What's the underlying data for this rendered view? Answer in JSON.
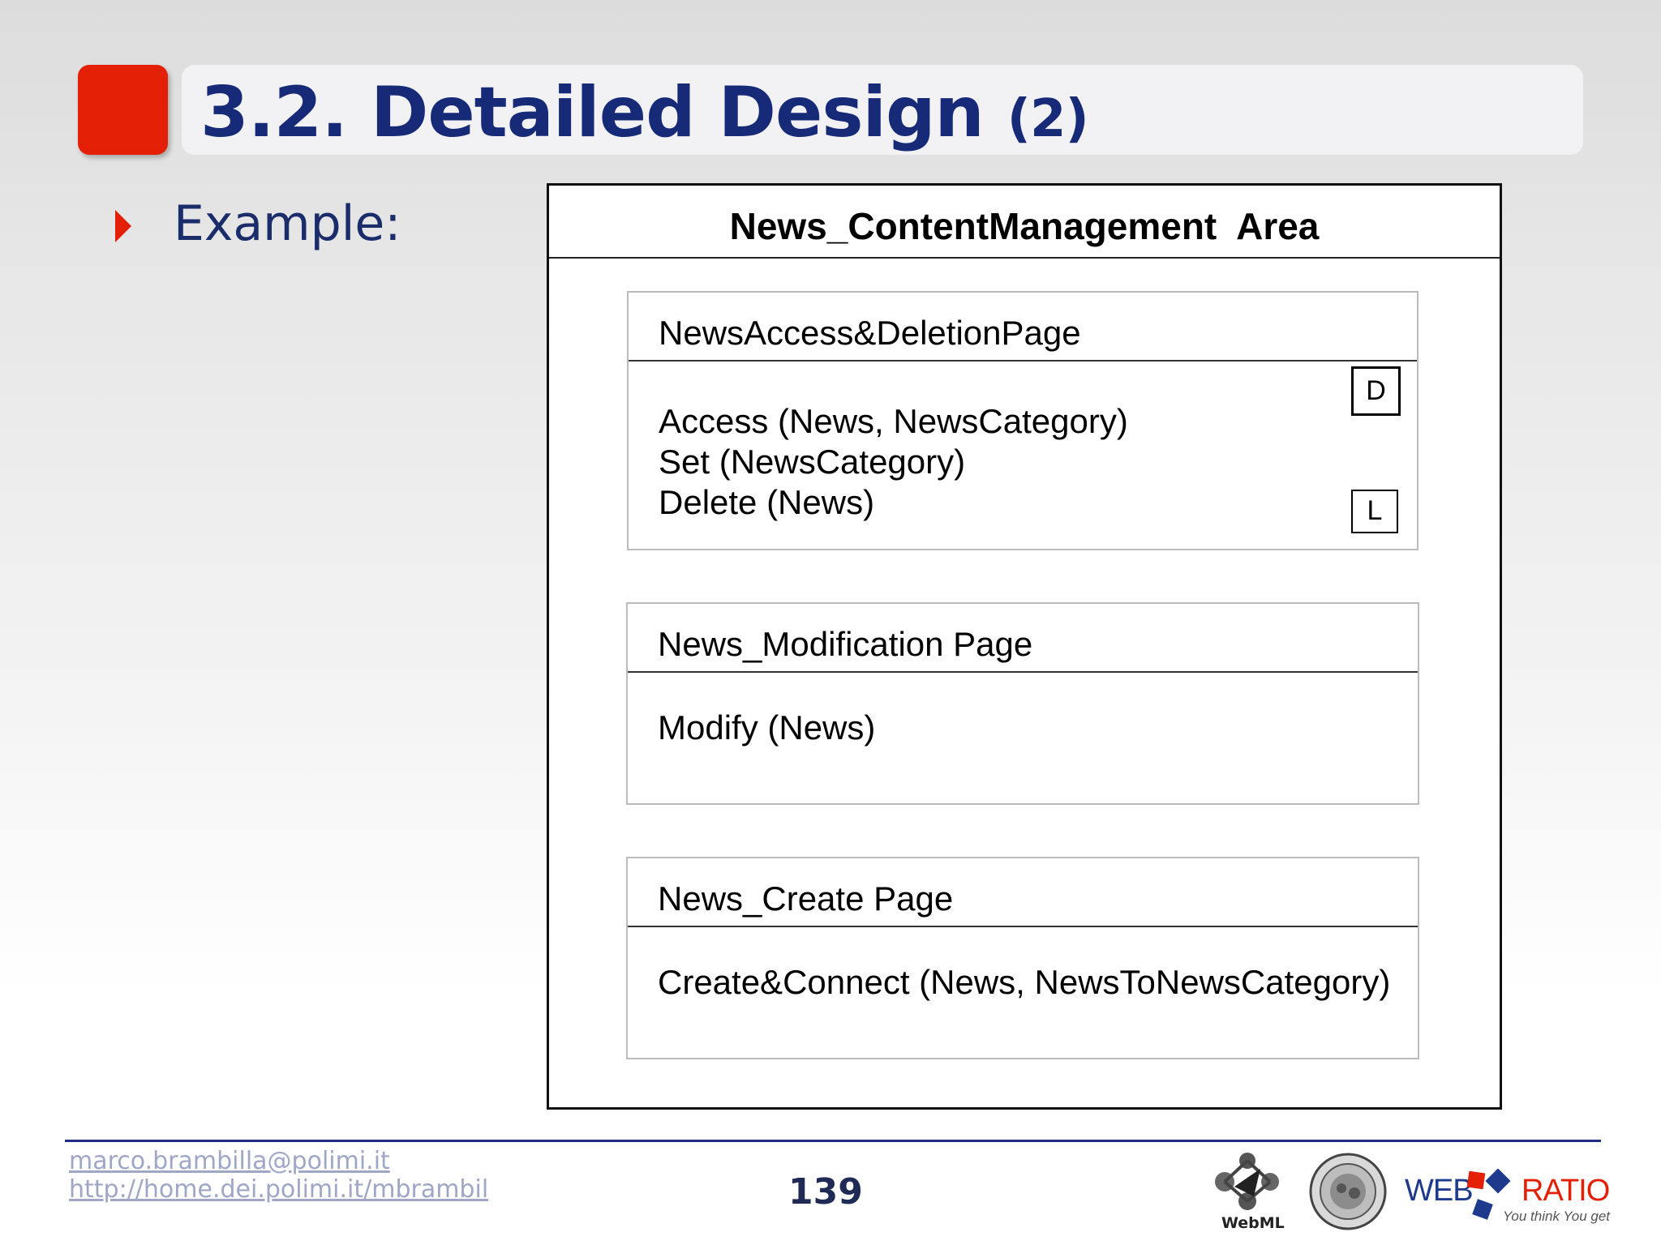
{
  "slide": {
    "title_main": "3.2. Detailed Design",
    "title_sub": "(2)",
    "bullet": "Example:"
  },
  "diagram": {
    "area_title": "News_ContentManagement  Area",
    "pages": [
      {
        "title": "NewsAccess&DeletionPage",
        "units": [
          "Access (News, NewsCategory)",
          "Set (NewsCategory)",
          "Delete (News)"
        ],
        "badges": [
          "D",
          "L"
        ]
      },
      {
        "title": "News_Modification Page",
        "units": [
          "Modify (News)"
        ]
      },
      {
        "title": "News_Create Page",
        "units": [
          "Create&Connect (News, NewsToNewsCategory)"
        ]
      }
    ]
  },
  "footer": {
    "email": "marco.brambilla@polimi.it",
    "url": "http://home.dei.polimi.it/mbrambil",
    "page_number": "139",
    "logos": {
      "webml_label": "WebML",
      "webratio_left": "WEB",
      "webratio_right": "RATIO",
      "webratio_tagline": "You think You get"
    }
  },
  "colors": {
    "accent_red": "#e32005",
    "title_blue": "#162a78",
    "footer_line": "#1f2e80"
  }
}
